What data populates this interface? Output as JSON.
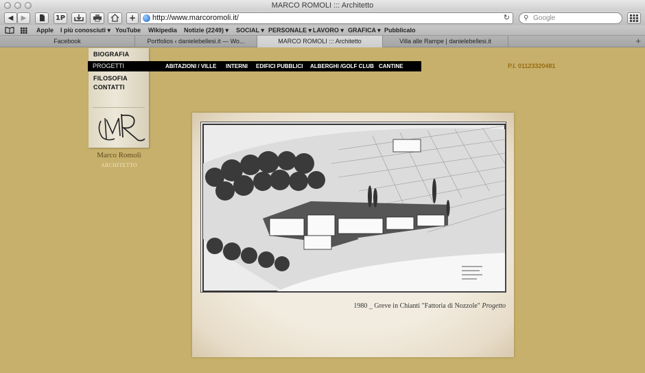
{
  "window": {
    "title": "MARCO ROMOLI ::: Architetto"
  },
  "toolbar": {
    "back": "◀",
    "forward": "▶",
    "onepassword": "1P",
    "add": "+",
    "url": "http://www.marcoromoli.it/",
    "reload": "↻",
    "search_placeholder": "Google",
    "search_icon": "⚲"
  },
  "bookmarks": [
    "Apple",
    "I più conosciuti ▾",
    "YouTube",
    "Wikipedia",
    "Notizie (2249) ▾",
    "SOCIAL ▾",
    "PERSONALE ▾",
    "LAVORO ▾",
    "GRAFICA ▾",
    "Pubblicalo"
  ],
  "tabs": [
    {
      "label": "Facebook"
    },
    {
      "label": "Portfolios ‹ danielebellesi.it — Wo..."
    },
    {
      "label": "MARCO ROMOLI ::: Architetto"
    },
    {
      "label": "Villa alle Rampe | danielebellesi.it"
    }
  ],
  "tab_add": "+",
  "site": {
    "menu": {
      "biografia": "BIOGRAFIA",
      "progetti": "PROGETTI",
      "filosofia": "FILOSOFIA",
      "contatti": "CONTATTI"
    },
    "submenu": [
      "ABITAZIONI / VILLE",
      "INTERNI",
      "EDIFICI PUBBLICI",
      "ALBERGHI /GOLF CLUB",
      "CANTINE"
    ],
    "piva": "P.I. 01123320481",
    "brand_name": "Marco Romoli",
    "brand_sub": "ARCHITETTO",
    "caption_main": "1980 _ Greve in Chianti \"Fattoria di Nozzole\"",
    "caption_italic": "Progetto"
  },
  "colors": {
    "page_bg": "#c6b06b",
    "nav_bg": "#000000",
    "piva": "#9a6b12"
  }
}
